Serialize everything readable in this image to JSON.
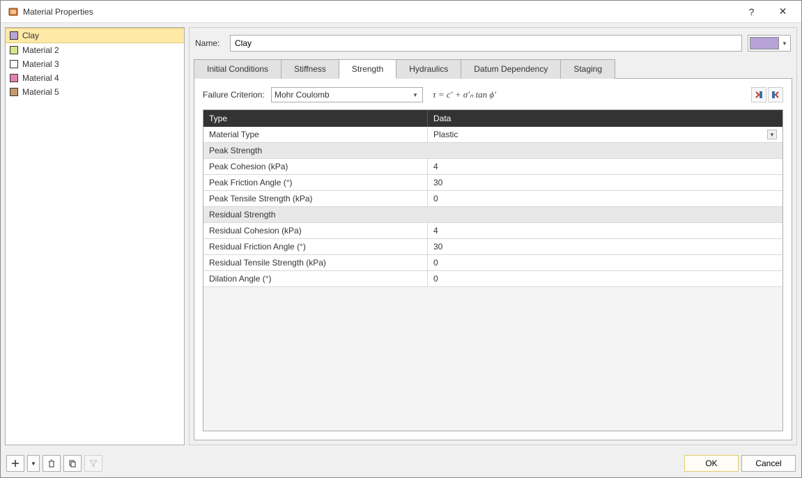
{
  "window": {
    "title": "Material Properties",
    "help": "?",
    "close": "✕"
  },
  "materials": {
    "items": [
      {
        "label": "Clay",
        "color": "#b8a3d8",
        "selected": true
      },
      {
        "label": "Material 2",
        "color": "#d7e58a",
        "selected": false
      },
      {
        "label": "Material 3",
        "color": "#ffffff",
        "selected": false
      },
      {
        "label": "Material 4",
        "color": "#e67fb2",
        "selected": false
      },
      {
        "label": "Material 5",
        "color": "#c49a6c",
        "selected": false
      }
    ]
  },
  "editor": {
    "name_label": "Name:",
    "name_value": "Clay",
    "color": "#b8a3d8"
  },
  "tabs": {
    "items": [
      {
        "label": "Initial Conditions",
        "active": false
      },
      {
        "label": "Stiffness",
        "active": false
      },
      {
        "label": "Strength",
        "active": true
      },
      {
        "label": "Hydraulics",
        "active": false
      },
      {
        "label": "Datum Dependency",
        "active": false
      },
      {
        "label": "Staging",
        "active": false
      }
    ]
  },
  "strength": {
    "criterion_label": "Failure Criterion:",
    "criterion_value": "Mohr Coulomb",
    "equation": "τ = c′ + σ′ₙ tan ϕ′",
    "table": {
      "header_type": "Type",
      "header_data": "Data",
      "rows": [
        {
          "kind": "prop_dd",
          "label": "Material Type",
          "value": "Plastic"
        },
        {
          "kind": "section",
          "label": "Peak Strength"
        },
        {
          "kind": "prop",
          "label": "Peak Cohesion (kPa)",
          "value": "4"
        },
        {
          "kind": "prop",
          "label": "Peak Friction Angle (°)",
          "value": "30"
        },
        {
          "kind": "prop",
          "label": "Peak Tensile Strength (kPa)",
          "value": "0"
        },
        {
          "kind": "section",
          "label": "Residual Strength"
        },
        {
          "kind": "prop",
          "label": "Residual Cohesion (kPa)",
          "value": "4"
        },
        {
          "kind": "prop",
          "label": "Residual Friction Angle (°)",
          "value": "30"
        },
        {
          "kind": "prop",
          "label": "Residual Tensile Strength (kPa)",
          "value": "0"
        },
        {
          "kind": "prop",
          "label": "Dilation Angle (°)",
          "value": "0"
        }
      ]
    }
  },
  "footer": {
    "ok": "OK",
    "cancel": "Cancel"
  }
}
